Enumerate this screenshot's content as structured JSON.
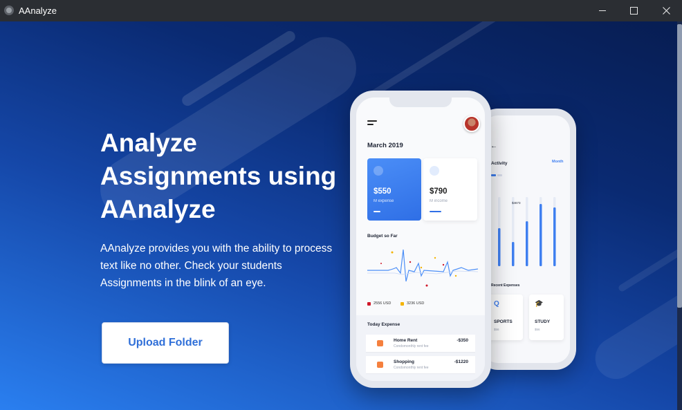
{
  "window": {
    "title": "AAnalyze",
    "controls": {
      "minimize": "minimize",
      "maximize": "maximize",
      "close": "close"
    }
  },
  "hero": {
    "title": "Analyze Assignments using AAnalyze",
    "description": "AAnalyze provides you with the ability to process text like no other. Check your students Assignments in the blink of an eye.",
    "upload_button": "Upload Folder"
  },
  "mockup_main": {
    "month": "March 2019",
    "card_expense": {
      "amount": "$550",
      "label": "M expense"
    },
    "card_income": {
      "amount": "$790",
      "label": "M income"
    },
    "budget_title": "Budget so Far",
    "legend": [
      {
        "label": "2556 USD",
        "color": "#d0182a"
      },
      {
        "label": "3236 USD",
        "color": "#f4b400"
      }
    ],
    "today_title": "Today Expense",
    "expenses": [
      {
        "name": "Home Rent",
        "sub": "Condomonthly rent fee",
        "amount": "-$350"
      },
      {
        "name": "Shopping",
        "sub": "Condomonthly rent fee",
        "amount": "-$1220"
      }
    ]
  },
  "mockup_secondary": {
    "back": "←",
    "activity_title": "Activity",
    "period": "Month",
    "bar_label": "$4673",
    "bar_values": [
      0.55,
      0.35,
      0.65,
      0.9,
      0.85
    ],
    "recent_title": "Recent Expenses",
    "tiles": [
      {
        "icon": "Q",
        "name": "SPORTS",
        "sub": "$56",
        "icon_color": "#3f7ff0"
      },
      {
        "icon": "🎓",
        "name": "STUDY",
        "sub": "$56",
        "icon_color": "#f5803e"
      }
    ]
  },
  "colors": {
    "accent": "#2f6fd8",
    "titlebar": "#2b2e33"
  }
}
